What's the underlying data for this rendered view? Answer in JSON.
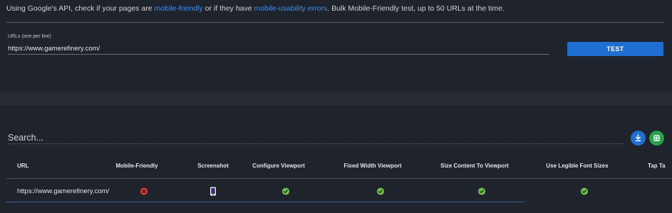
{
  "intro": {
    "part1": "Using Google's API, check if your pages are ",
    "link1": "mobile-friendly",
    "part2": " or if they have ",
    "link2": "mobile-usability errors",
    "part3": ". Bulk Mobile-Friendly test, up to 50 URLs at the time."
  },
  "form": {
    "label": "URLs (one per line)",
    "value": "https://www.gamerefinery.com/",
    "test_label": "TEST"
  },
  "results": {
    "search_placeholder": "Search...",
    "columns": [
      "URL",
      "Mobile-Friendly",
      "Screenshot",
      "Configure Viewport",
      "Fixed Width Viewport",
      "Size Content To Viewport",
      "Use Legible Font Sizes",
      "Tap Ta"
    ],
    "rows": [
      {
        "url": "https://www.gamerefinery.com/",
        "mobile_friendly": "fail-icon",
        "screenshot": "phone-icon",
        "configure_viewport": "pass-icon",
        "fixed_width_viewport": "pass-icon",
        "size_content_to_viewport": "pass-icon",
        "use_legible_font_sizes": "pass-icon"
      }
    ]
  },
  "colors": {
    "background": "#1f232b",
    "accent": "#1f6fd1",
    "link": "#3f8fe6",
    "pass": "#6cc04a",
    "fail": "#e53935",
    "sheets": "#2aa14f"
  }
}
